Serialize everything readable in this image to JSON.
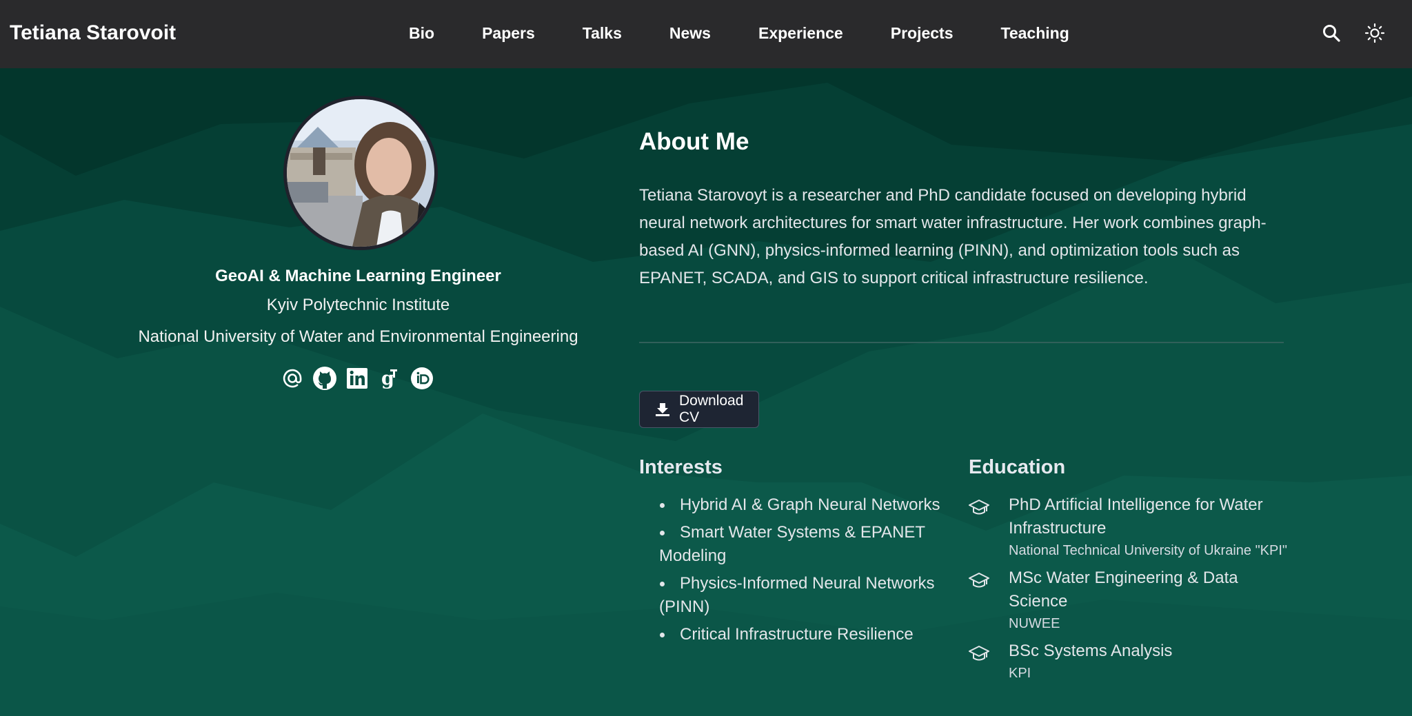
{
  "nav": {
    "brand": "Tetiana Starovoit",
    "items": [
      {
        "label": "Bio"
      },
      {
        "label": "Papers"
      },
      {
        "label": "Talks"
      },
      {
        "label": "News"
      },
      {
        "label": "Experience"
      },
      {
        "label": "Projects"
      },
      {
        "label": "Teaching"
      }
    ],
    "icons": [
      "search-icon",
      "sun-icon"
    ]
  },
  "profile": {
    "role": "GeoAI & Machine Learning Engineer",
    "org1": "Kyiv Polytechnic Institute",
    "org2": "National University of Water and Environmental Engineering",
    "socials": [
      "email-icon",
      "github-icon",
      "linkedin-icon",
      "google-scholar-icon",
      "orcid-icon"
    ]
  },
  "about": {
    "title": "About Me",
    "text": "Tetiana Starovoyt is a researcher and PhD candidate focused on developing hybrid neural network architectures for smart water infrastructure. Her work combines graph-based AI (GNN), physics-informed learning (PINN), and optimization tools such as EPANET, SCADA, and GIS to support critical infrastructure resilience.",
    "cv_label": "Download CV"
  },
  "interests": {
    "title": "Interests",
    "items": [
      "Hybrid AI & Graph Neural Networks",
      "Smart Water Systems & EPANET Modeling",
      "Physics-Informed Neural Networks (PINN)",
      "Critical Infrastructure Resilience"
    ]
  },
  "education": {
    "title": "Education",
    "items": [
      {
        "degree": "PhD Artificial Intelligence for Water Infrastructure",
        "institution": "National Technical University of Ukraine \"KPI\""
      },
      {
        "degree": "MSc Water Engineering & Data Science",
        "institution": "NUWEE"
      },
      {
        "degree": "BSc Systems Analysis",
        "institution": "KPI"
      }
    ]
  },
  "colors": {
    "navbar": "#2a2a2c",
    "background_dark": "#022d24",
    "background_light": "#0a5a4c",
    "button": "#1e2533"
  }
}
